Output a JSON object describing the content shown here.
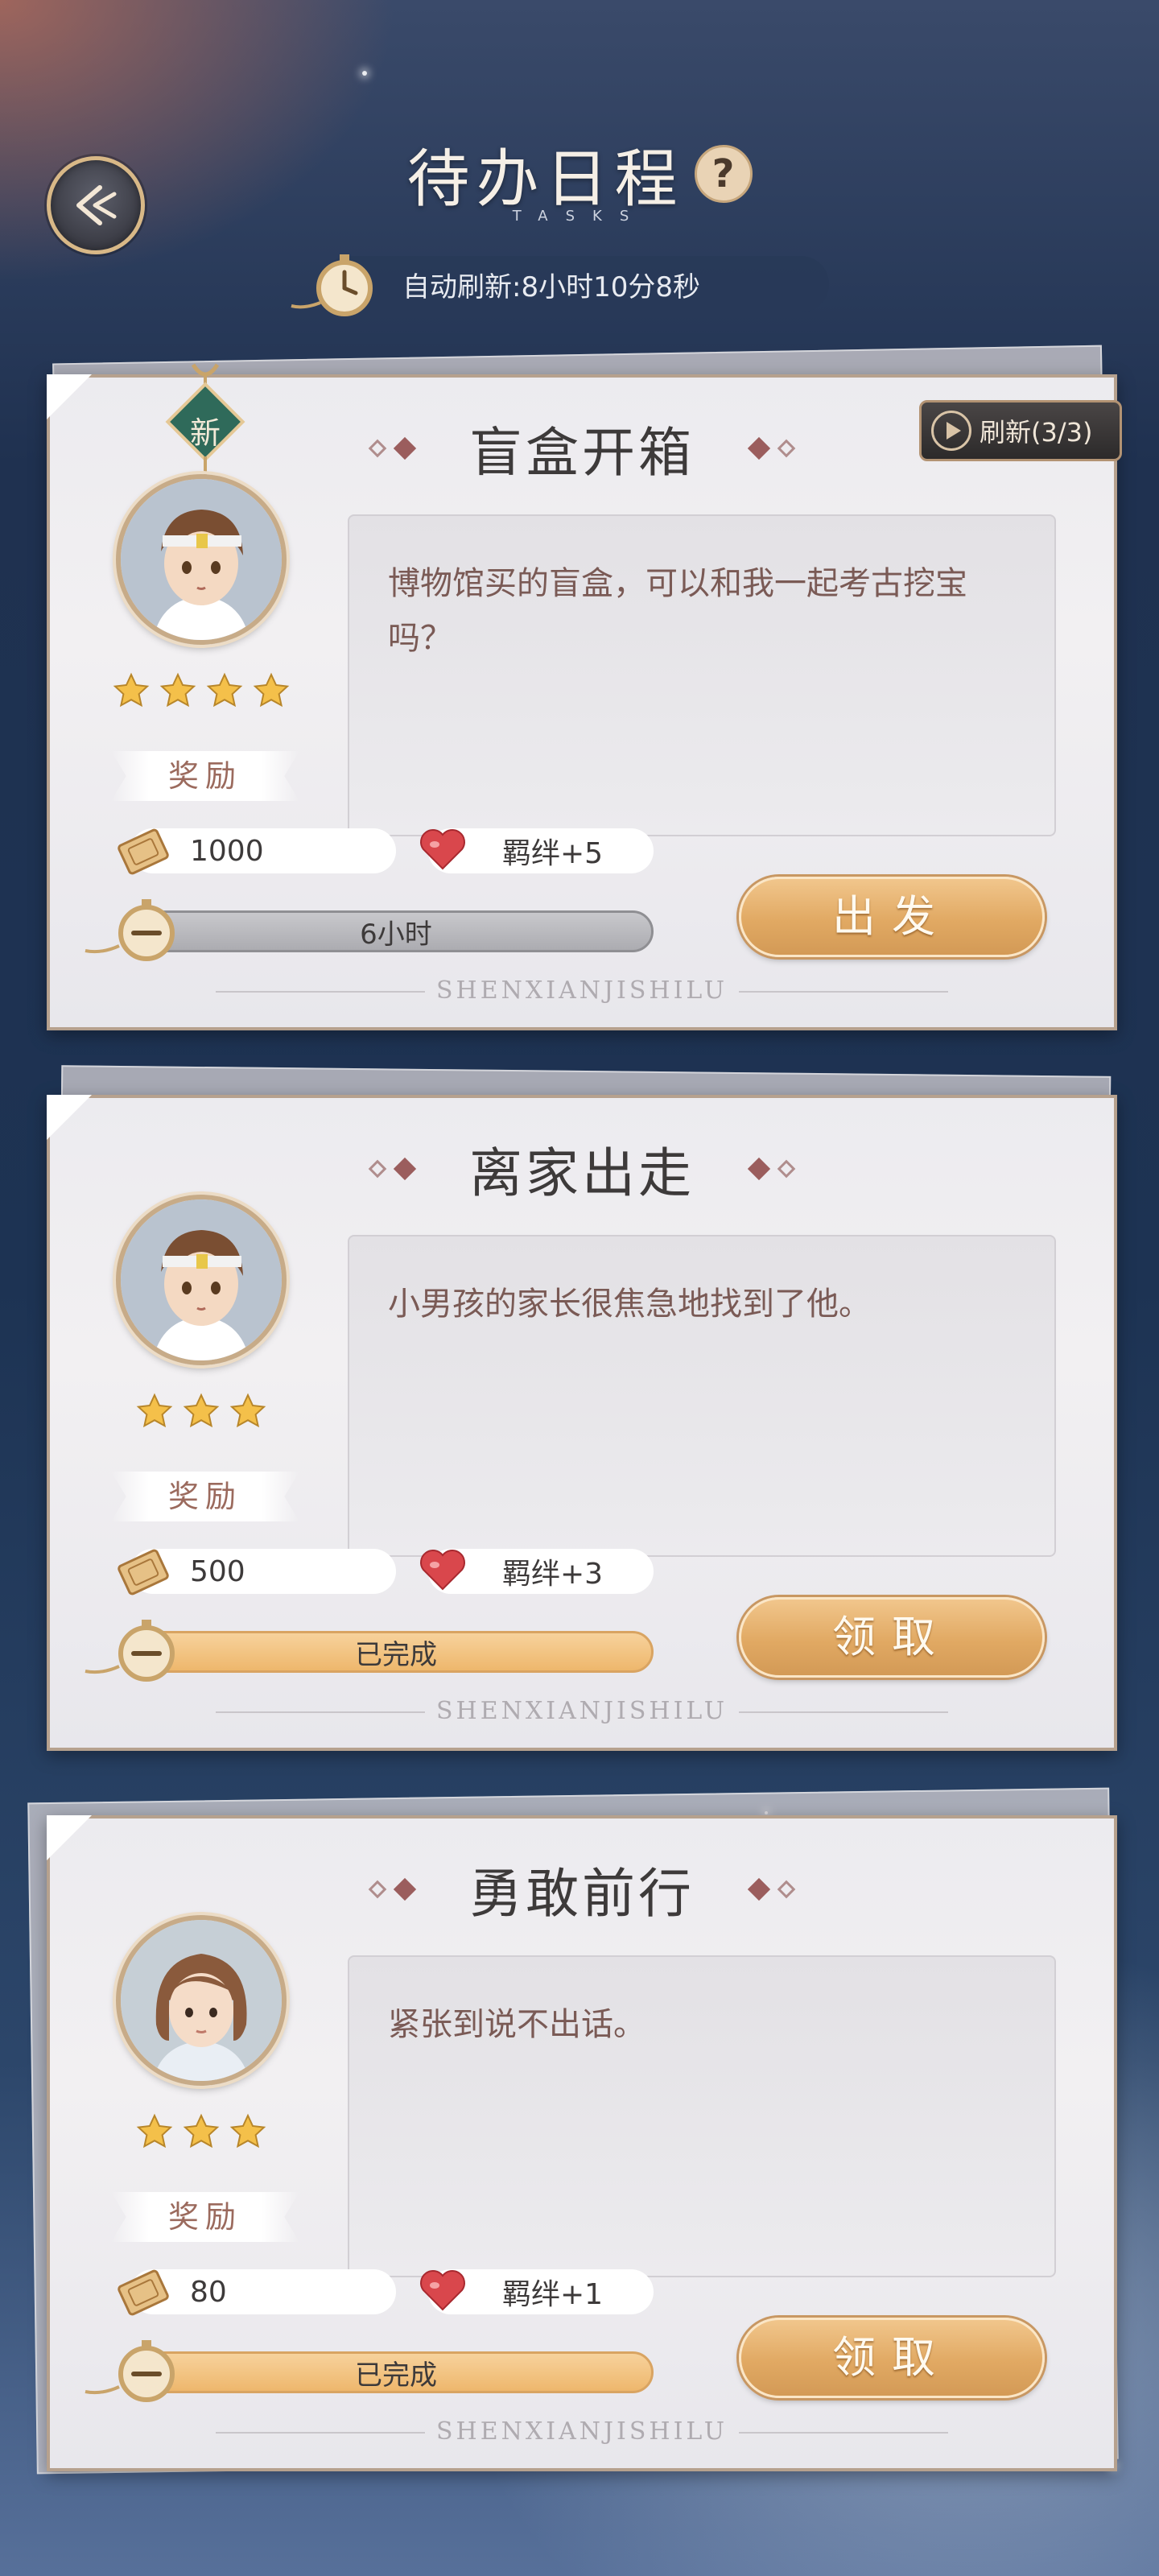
{
  "header": {
    "title": "待办日程",
    "subtitle": "TASKS",
    "help_icon_text": "?",
    "auto_refresh": "自动刷新:8小时10分8秒",
    "back_icon": "back-arrow-icon"
  },
  "tasks": [
    {
      "title": "盲盒开箱",
      "is_new": true,
      "new_badge": "新",
      "refresh_label": "刷新(3/3)",
      "stars": 4,
      "description": "博物馆买的盲盒，可以和我一起考古挖宝吗？",
      "reward_label": "奖励",
      "gold": "1000",
      "bond": "羁绊+5",
      "status_text": "6小时",
      "status": "running",
      "action_label": "出发",
      "watermark": "SHENXIANJISHILU",
      "avatar": "boy-headband"
    },
    {
      "title": "离家出走",
      "is_new": false,
      "stars": 3,
      "description": "小男孩的家长很焦急地找到了他。",
      "reward_label": "奖励",
      "gold": "500",
      "bond": "羁绊+3",
      "status_text": "已完成",
      "status": "done",
      "action_label": "领取",
      "watermark": "SHENXIANJISHILU",
      "avatar": "boy-headband"
    },
    {
      "title": "勇敢前行",
      "is_new": false,
      "stars": 3,
      "description": "紧张到说不出话。",
      "reward_label": "奖励",
      "gold": "80",
      "bond": "羁绊+1",
      "status_text": "已完成",
      "status": "done",
      "action_label": "领取",
      "watermark": "SHENXIANJISHILU",
      "avatar": "girl-bob"
    }
  ],
  "colors": {
    "accent_gold": "#e1a963",
    "title_text": "#3d3a3a",
    "desc_text": "#7a5a55",
    "progress_done": "#f0bd76",
    "progress_running": "#b8b8bd"
  }
}
